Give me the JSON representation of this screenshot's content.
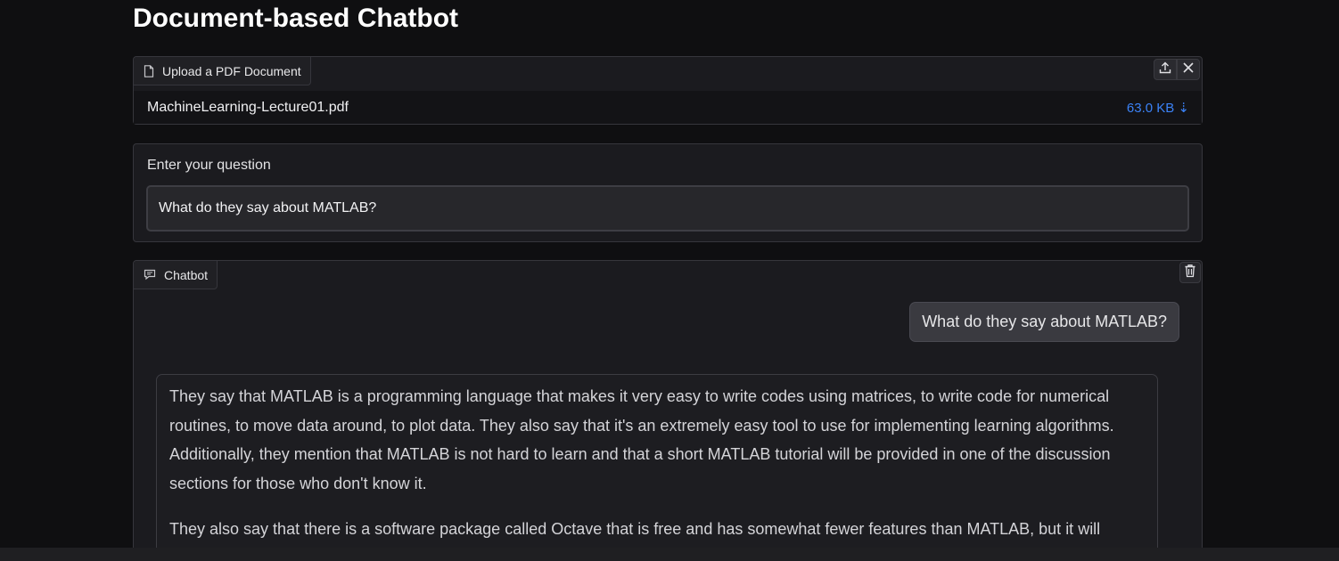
{
  "page": {
    "title": "Document-based Chatbot"
  },
  "upload": {
    "label": "Upload a PDF Document",
    "label_icon": "file-icon",
    "actions": [
      "upload-icon",
      "close-icon"
    ],
    "file_name": "MachineLearning-Lecture01.pdf",
    "file_size": "63.0 KB ⇣"
  },
  "question": {
    "label": "Enter your question",
    "value": "What do they say about MATLAB?"
  },
  "chatbot": {
    "label": "Chatbot",
    "label_icon": "chat-icon",
    "clear_icon": "trash-icon",
    "messages": [
      {
        "role": "user",
        "text": "What do they say about MATLAB?"
      },
      {
        "role": "bot",
        "paragraphs": [
          "They say that MATLAB is a programming language that makes it very easy to write codes using matrices, to write code for numerical routines, to move data around, to plot data. They also say that it's an extremely easy tool to use for implementing learning algorithms. Additionally, they mention that MATLAB is not hard to learn and that a short MATLAB tutorial will be provided in one of the discussion sections for those who don't know it.",
          "They also say that there is a software package called Octave that is free and has somewhat fewer features than MATLAB, but it will"
        ]
      }
    ]
  },
  "colors": {
    "background": "#0f0f11",
    "panel": "#1b1b1f",
    "accent_link": "#3b82f6"
  }
}
